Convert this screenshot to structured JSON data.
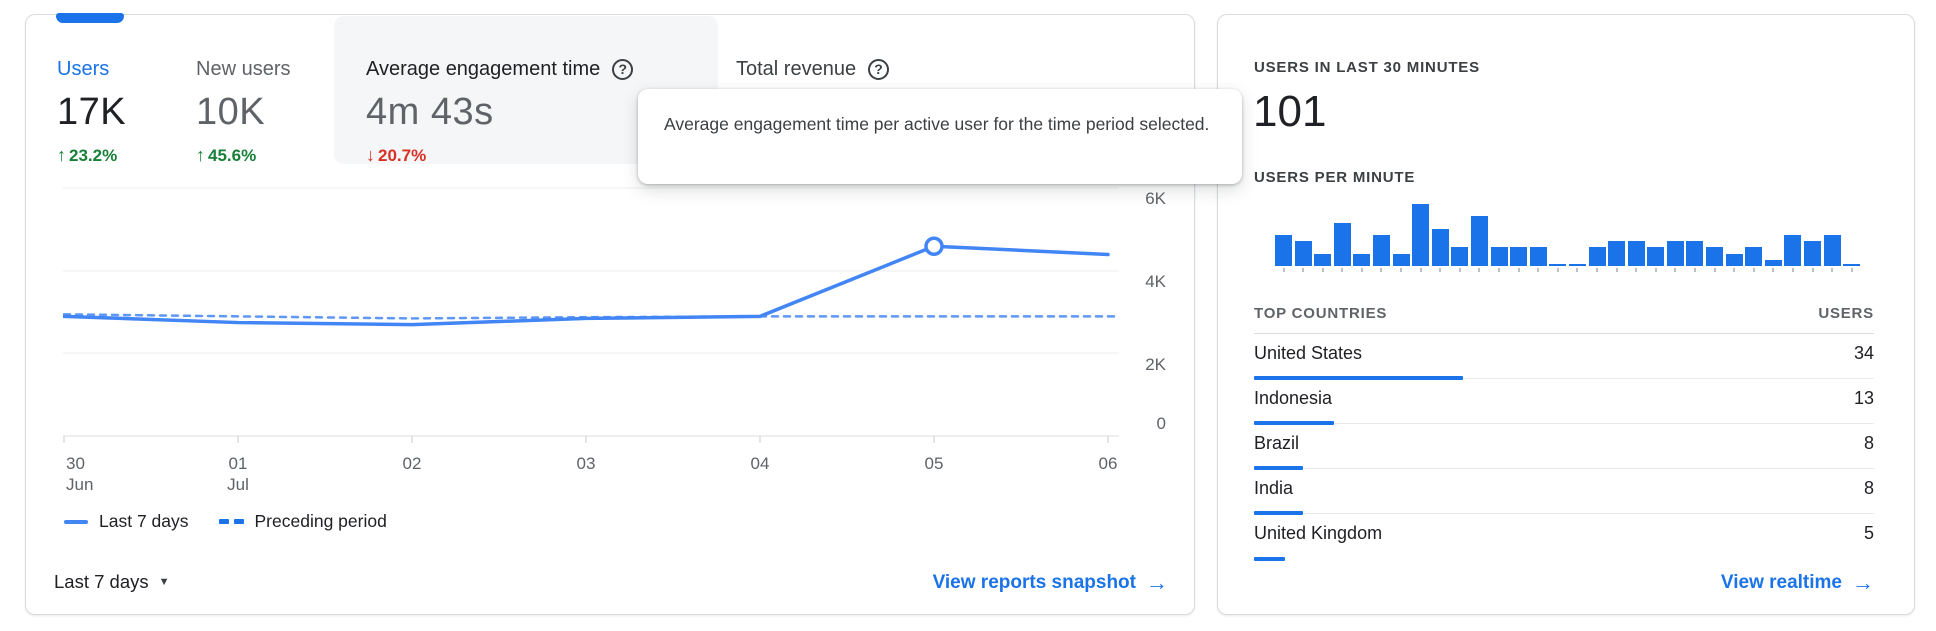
{
  "left_card": {
    "tabs": [
      {
        "label": "Users",
        "value": "17K",
        "delta": "23.2%",
        "direction": "up",
        "selected": true
      },
      {
        "label": "New users",
        "value": "10K",
        "delta": "45.6%",
        "direction": "up"
      },
      {
        "label": "Average engagement time",
        "value": "4m 43s",
        "delta": "20.7%",
        "direction": "down",
        "has_info_icon": true,
        "hovered": true
      },
      {
        "label": "Total revenue",
        "has_info_icon": true
      }
    ],
    "up_arrow": "↑",
    "down_arrow": "↓",
    "help_glyph": "?",
    "tooltip_text": "Average engagement time per active user for the time period selected.",
    "legend": [
      {
        "label": "Last 7 days",
        "style": "solid"
      },
      {
        "label": "Preceding period",
        "style": "dashed"
      }
    ],
    "range_label": "Last 7 days",
    "range_caret": "▼",
    "snapshot_link": "View reports snapshot",
    "link_arrow": "→"
  },
  "right_card": {
    "users_30_label": "USERS IN LAST 30 MINUTES",
    "users_30_value": "101",
    "per_minute_label": "USERS PER MINUTE",
    "realtime_link": "View realtime",
    "link_arrow": "→"
  },
  "colors": {
    "accent_blue": "#1a73e8",
    "line_blue": "#4285f4",
    "delta_green": "#188038",
    "delta_red": "#d93025"
  },
  "chart_data": [
    {
      "type": "line",
      "x": [
        "30 Jun",
        "01 Jul",
        "02",
        "03",
        "04",
        "05",
        "06"
      ],
      "series": [
        {
          "name": "Last 7 days",
          "style": "solid",
          "values_k": [
            2.9,
            2.75,
            2.7,
            2.85,
            2.9,
            4.6,
            4.4
          ]
        },
        {
          "name": "Preceding period",
          "style": "dashed",
          "values_k": [
            2.95,
            2.9,
            2.85,
            2.88,
            2.9,
            2.9,
            2.9
          ]
        }
      ],
      "yticks": [
        "6K",
        "4K",
        "2K",
        "0"
      ],
      "ylim_k": [
        0,
        6
      ],
      "grid": true,
      "legend_position": "bottom",
      "highlight_point": {
        "series": "Last 7 days",
        "x": "05",
        "value_k": 4.6
      }
    },
    {
      "type": "bar",
      "title": "USERS PER MINUTE",
      "values": [
        5,
        4,
        2,
        7,
        2,
        5,
        2,
        10,
        6,
        3,
        8,
        3,
        3,
        3,
        0,
        0,
        3,
        4,
        4,
        3,
        4,
        4,
        3,
        2,
        3,
        1,
        5,
        4,
        5,
        0
      ],
      "ylim": [
        0,
        10
      ]
    },
    {
      "type": "table",
      "columns": [
        "TOP COUNTRIES",
        "USERS"
      ],
      "rows": [
        [
          "United States",
          34
        ],
        [
          "Indonesia",
          13
        ],
        [
          "Brazil",
          8
        ],
        [
          "India",
          8
        ],
        [
          "United Kingdom",
          5
        ]
      ],
      "total_users": 101
    }
  ]
}
